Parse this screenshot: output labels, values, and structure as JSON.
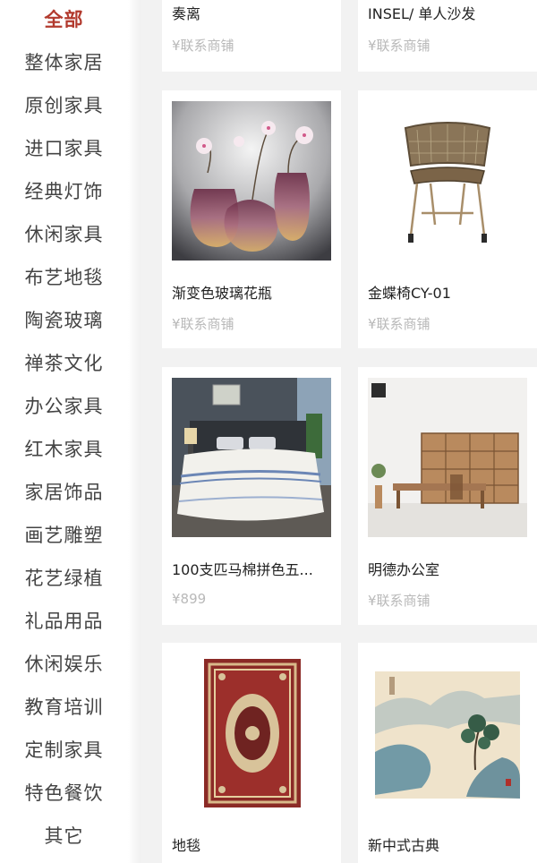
{
  "sidebar": {
    "items": [
      {
        "label": "全部",
        "active": true
      },
      {
        "label": "整体家居"
      },
      {
        "label": "原创家具"
      },
      {
        "label": "进口家具"
      },
      {
        "label": "经典灯饰"
      },
      {
        "label": "休闲家具"
      },
      {
        "label": "布艺地毯"
      },
      {
        "label": "陶瓷玻璃"
      },
      {
        "label": "禅茶文化"
      },
      {
        "label": "办公家具"
      },
      {
        "label": "红木家具"
      },
      {
        "label": "家居饰品"
      },
      {
        "label": "画艺雕塑"
      },
      {
        "label": "花艺绿植"
      },
      {
        "label": "礼品用品"
      },
      {
        "label": "休闲娱乐"
      },
      {
        "label": "教育培训"
      },
      {
        "label": "定制家具"
      },
      {
        "label": "特色餐饮"
      },
      {
        "label": "其它"
      }
    ]
  },
  "products": [
    {
      "name": "奏离",
      "price": "¥联系商铺"
    },
    {
      "name": "INSEL/ 单人沙发",
      "price": "¥联系商铺"
    },
    {
      "name": "渐变色玻璃花瓶",
      "price": "¥联系商铺"
    },
    {
      "name": "金蝶椅CY-01",
      "price": "¥联系商铺"
    },
    {
      "name": "100支匹马棉拼色五...",
      "price": "¥899"
    },
    {
      "name": "明德办公室",
      "price": "¥联系商铺"
    },
    {
      "name": "地毯",
      "price": ""
    },
    {
      "name": "新中式古典",
      "price": ""
    }
  ],
  "colors": {
    "active": "#b23a2e",
    "price": "#b9b9b9",
    "background": "#f2f2f2"
  },
  "icons": {
    "vase": "vase-image",
    "chair": "chair-image",
    "bed": "bed-image",
    "office": "office-image",
    "rug": "rug-image",
    "painting": "painting-image"
  }
}
